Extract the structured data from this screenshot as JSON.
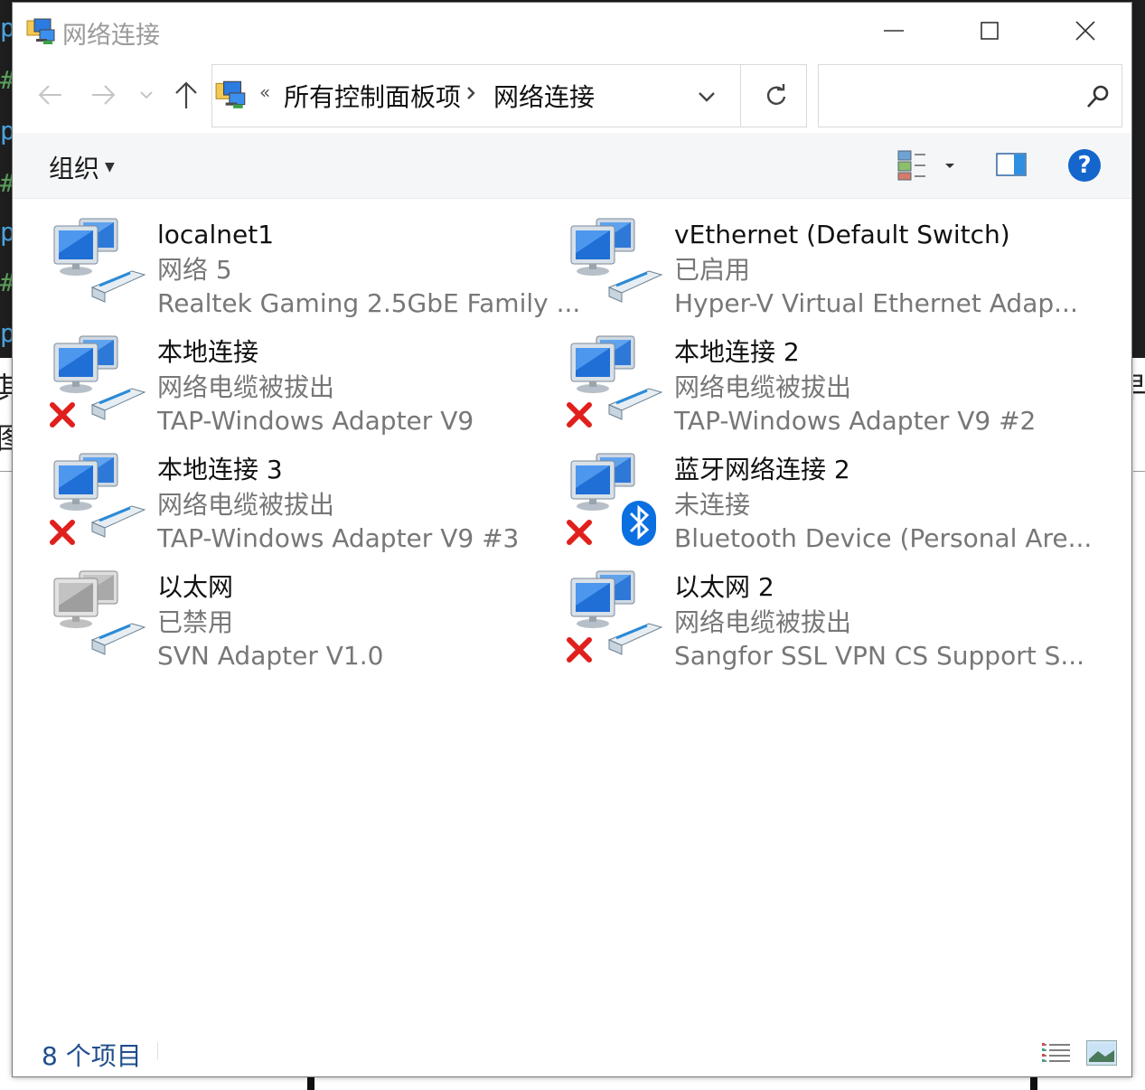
{
  "window": {
    "title": "网络连接",
    "breadcrumb": [
      "所有控制面板项",
      "网络连接"
    ],
    "breadcrumb_overflow": "«",
    "search_placeholder": "",
    "organize_label": "组织",
    "help_label": "?",
    "status_count": "8 个项目"
  },
  "connections": [
    {
      "name": "localnet1",
      "status": "网络 5",
      "device": "Realtek Gaming 2.5GbE Family ...",
      "icon": "network-adapter-icon",
      "state": "connected"
    },
    {
      "name": "vEthernet (Default Switch)",
      "status": "已启用",
      "device": "Hyper-V Virtual Ethernet Adap...",
      "icon": "network-adapter-icon",
      "state": "connected"
    },
    {
      "name": "本地连接",
      "status": "网络电缆被拔出",
      "device": "TAP-Windows Adapter V9",
      "icon": "network-adapter-icon",
      "state": "unplugged"
    },
    {
      "name": "本地连接 2",
      "status": "网络电缆被拔出",
      "device": "TAP-Windows Adapter V9 #2",
      "icon": "network-adapter-icon",
      "state": "unplugged"
    },
    {
      "name": "本地连接 3",
      "status": "网络电缆被拔出",
      "device": "TAP-Windows Adapter V9 #3",
      "icon": "network-adapter-icon",
      "state": "unplugged"
    },
    {
      "name": "蓝牙网络连接 2",
      "status": "未连接",
      "device": "Bluetooth Device (Personal Are...",
      "icon": "bluetooth-adapter-icon",
      "state": "unplugged"
    },
    {
      "name": "以太网",
      "status": "已禁用",
      "device": "SVN Adapter V1.0",
      "icon": "network-adapter-icon",
      "state": "disabled"
    },
    {
      "name": "以太网 2",
      "status": "网络电缆被拔出",
      "device": "Sangfor SSL VPN CS Support S...",
      "icon": "network-adapter-icon",
      "state": "unplugged"
    }
  ],
  "colors": {
    "accent": "#1466cc",
    "status_text": "#1f4e8c",
    "error": "#e0201c",
    "bluetooth": "#0a6fe0"
  },
  "background": {
    "left_glyphs": [
      "p",
      "#",
      "p",
      "#",
      "p",
      "#",
      "p"
    ],
    "side_chars": [
      "其",
      "图",
      "早"
    ]
  }
}
